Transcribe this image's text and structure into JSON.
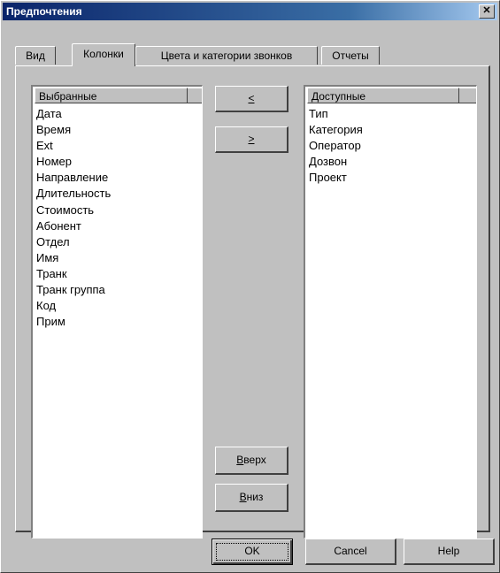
{
  "window": {
    "title": "Предпочтения",
    "close_label": "✕"
  },
  "tabs": [
    {
      "label": "Вид"
    },
    {
      "label": "Колонки"
    },
    {
      "label": "Цвета и категории звонков"
    },
    {
      "label": "Отчеты"
    }
  ],
  "active_tab": "Колонки",
  "selected": {
    "header": "Выбранные",
    "items": [
      "Дата",
      "Время",
      "Ext",
      "Номер",
      "Направление",
      "Длительность",
      "Стоимость",
      "Абонент",
      "Отдел",
      "Имя",
      "Транк",
      "Транк группа",
      "Код",
      "Прим"
    ]
  },
  "available": {
    "header": "Доступные",
    "items": [
      "Тип",
      "Категория",
      "Оператор",
      "Дозвон",
      "Проект"
    ]
  },
  "buttons": {
    "move_left": "<",
    "move_right": ">",
    "up_accel": "В",
    "up_rest": "верх",
    "down_accel": "В",
    "down_rest": "низ",
    "ok": "OK",
    "cancel": "Cancel",
    "help": "Help"
  },
  "colors": {
    "face": "#c0c0c0",
    "title_start": "#0a246a",
    "title_end": "#a6caf0"
  }
}
